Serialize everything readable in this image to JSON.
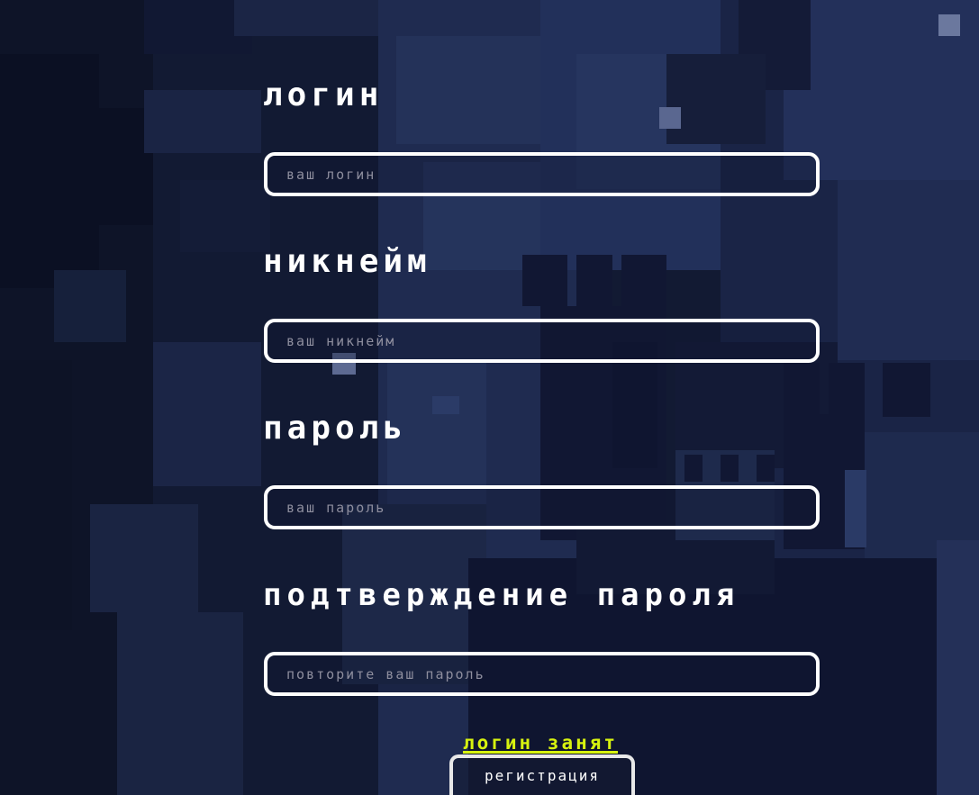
{
  "form": {
    "login_label": "логин",
    "login_placeholder": "ваш логин",
    "nickname_label": "никнейм",
    "nickname_placeholder": "ваш никнейм",
    "password_label": "пароль",
    "password_placeholder": "ваш пароль",
    "confirm_label": "подтверждение пароля",
    "confirm_placeholder": "повторите ваш пароль",
    "error_message": "логин занят",
    "submit_label": "регистрация"
  },
  "colors": {
    "background": "#121a33",
    "accent_error": "#d7f20f",
    "input_border": "#ffffff"
  }
}
